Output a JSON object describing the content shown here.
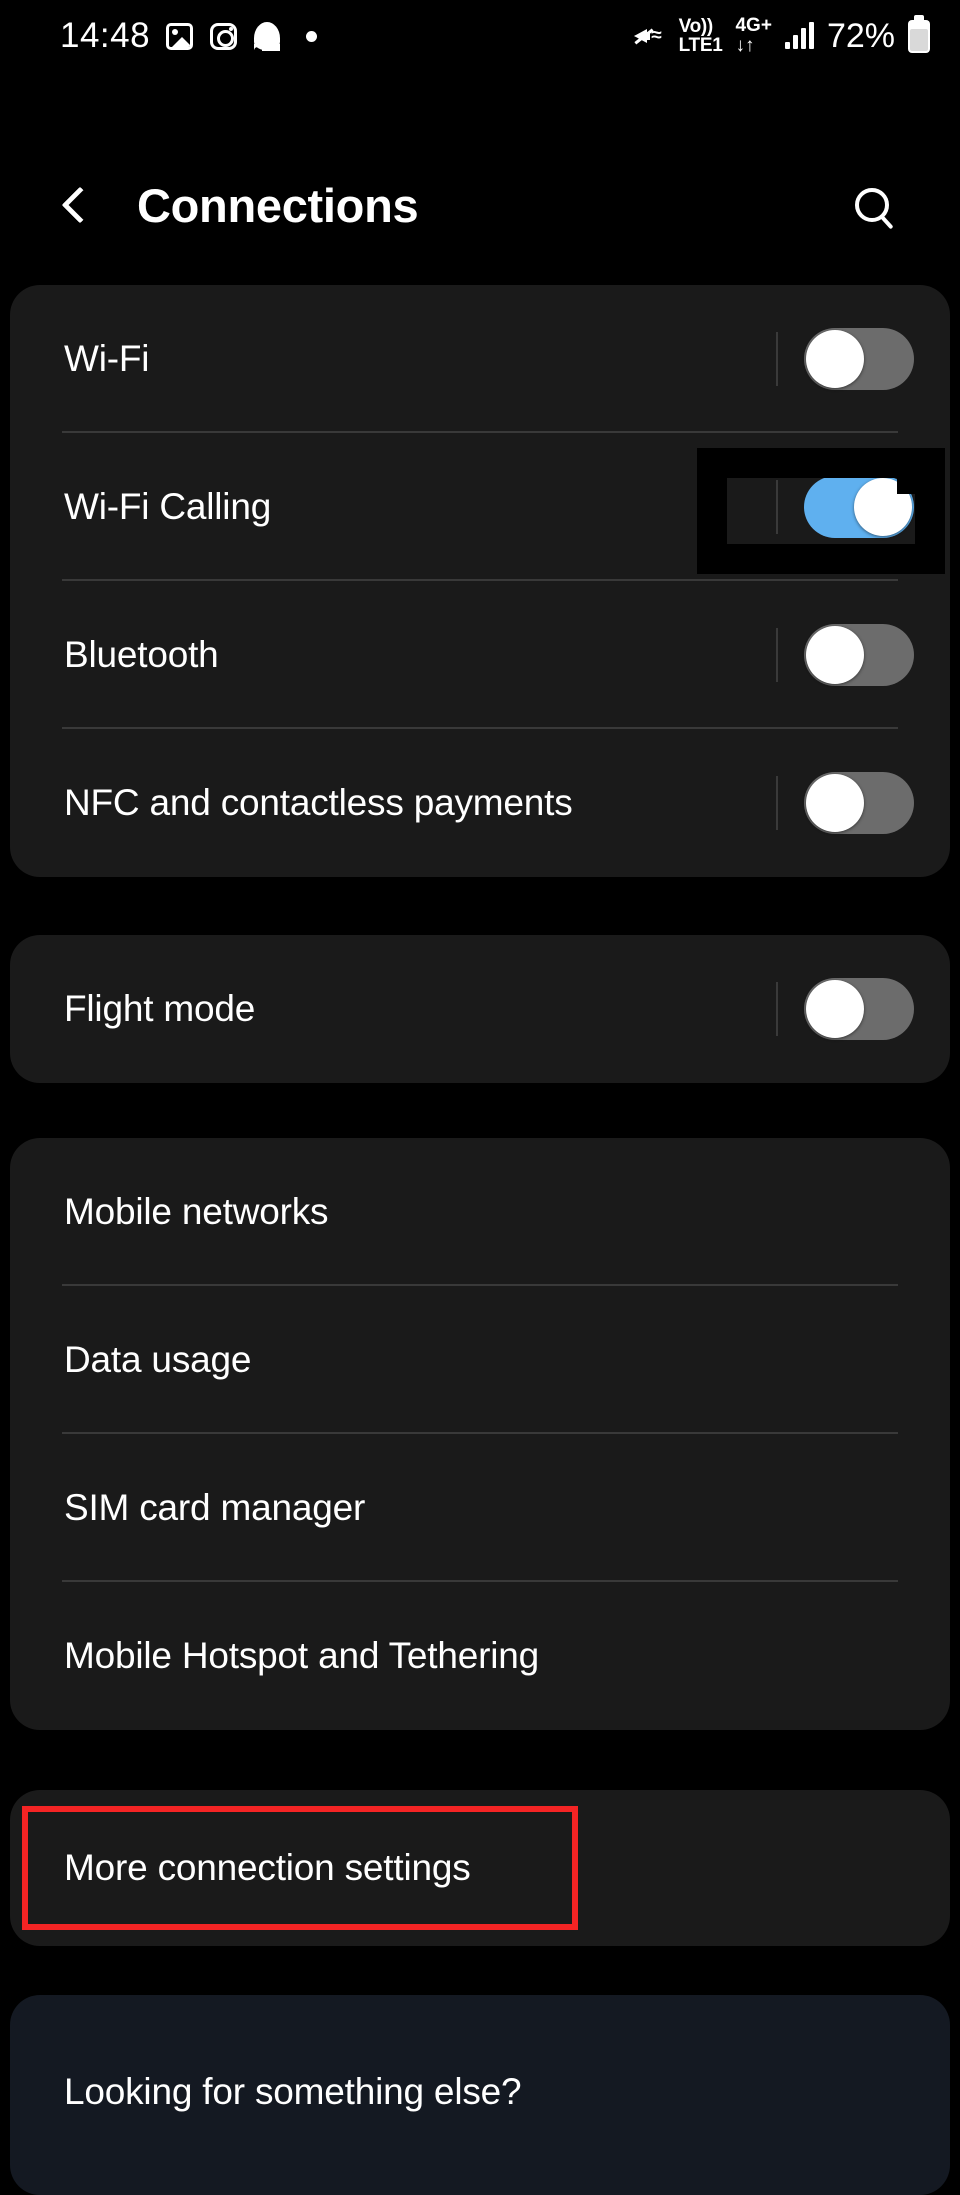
{
  "status_bar": {
    "clock": "14:48",
    "left_icons": [
      "gallery-icon",
      "instagram-icon",
      "snapchat-icon",
      "dot-icon"
    ],
    "right_icons": [
      "mute-vibrate-icon",
      "volte-icon",
      "network-4g-plus-icon",
      "signal-bars-icon",
      "battery-icon"
    ],
    "volte_line1": "Vo))",
    "volte_line2": "LTE1",
    "network_type": "4G+",
    "data_arrows": "↓↑",
    "battery_percent": "72%"
  },
  "app_bar": {
    "back_label": "back-button",
    "title": "Connections",
    "search_label": "search-button"
  },
  "sections": [
    {
      "id": "connectivity",
      "rows": [
        {
          "label": "Wi-Fi",
          "type": "toggle",
          "state": "off"
        },
        {
          "label": "Wi-Fi Calling",
          "type": "toggle",
          "state": "on"
        },
        {
          "label": "Bluetooth",
          "type": "toggle",
          "state": "off"
        },
        {
          "label": "NFC and contactless payments",
          "type": "toggle",
          "state": "off"
        }
      ]
    },
    {
      "id": "flight",
      "rows": [
        {
          "label": "Flight mode",
          "type": "toggle",
          "state": "off"
        }
      ]
    },
    {
      "id": "network",
      "rows": [
        {
          "label": "Mobile networks",
          "type": "link"
        },
        {
          "label": "Data usage",
          "type": "link"
        },
        {
          "label": "SIM card manager",
          "type": "link"
        },
        {
          "label": "Mobile Hotspot and Tethering",
          "type": "link"
        }
      ]
    },
    {
      "id": "more",
      "rows": [
        {
          "label": "More connection settings",
          "type": "link"
        }
      ]
    },
    {
      "id": "looking",
      "rows": [
        {
          "label": "Looking for something else?",
          "type": "link"
        }
      ]
    }
  ],
  "annotations": {
    "black_box_target": "Wi-Fi Calling toggle",
    "red_box_target": "More connection settings",
    "red_color": "#f42424",
    "black_color": "#000000"
  },
  "colors": {
    "background": "#000000",
    "card": "#1a1a1a",
    "card_tinted": "#141922",
    "toggle_on": "#5fb0ef",
    "toggle_off": "#6c6c6c",
    "divider": "#393939",
    "text": "#ffffff"
  }
}
